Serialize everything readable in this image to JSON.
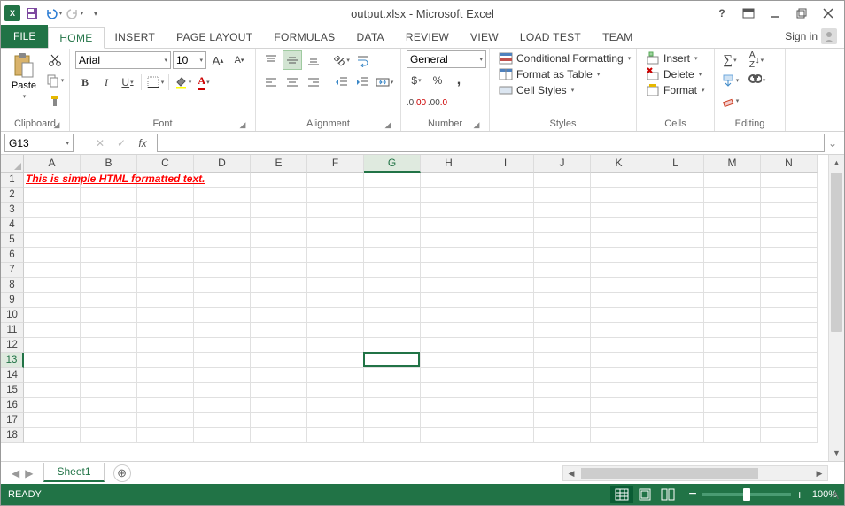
{
  "title": "output.xlsx - Microsoft Excel",
  "qat": {
    "save": "💾"
  },
  "signin_label": "Sign in",
  "tabs": {
    "file": "FILE",
    "home": "HOME",
    "insert": "INSERT",
    "page_layout": "PAGE LAYOUT",
    "formulas": "FORMULAS",
    "data": "DATA",
    "review": "REVIEW",
    "view": "VIEW",
    "load_test": "LOAD TEST",
    "team": "TEAM"
  },
  "ribbon": {
    "clipboard": {
      "label": "Clipboard",
      "paste": "Paste"
    },
    "font": {
      "label": "Font",
      "name": "Arial",
      "size": "10",
      "B": "B",
      "I": "I",
      "U": "U"
    },
    "alignment": {
      "label": "Alignment"
    },
    "number": {
      "label": "Number",
      "format": "General",
      "currency": "$",
      "percent": "%",
      "comma": ","
    },
    "styles": {
      "label": "Styles",
      "cond_fmt": "Conditional Formatting",
      "table": "Format as Table",
      "cell": "Cell Styles"
    },
    "cells": {
      "label": "Cells",
      "insert": "Insert",
      "delete": "Delete",
      "format": "Format"
    },
    "editing": {
      "label": "Editing"
    }
  },
  "namebox": "G13",
  "formula": "",
  "columns": [
    "A",
    "B",
    "C",
    "D",
    "E",
    "F",
    "G",
    "H",
    "I",
    "J",
    "K",
    "L",
    "M",
    "N"
  ],
  "rows": [
    1,
    2,
    3,
    4,
    5,
    6,
    7,
    8,
    9,
    10,
    11,
    12,
    13,
    14,
    15,
    16,
    17,
    18
  ],
  "cell_A1": "This is simple HTML formatted text.",
  "active_col": "G",
  "active_row": 13,
  "sheet": {
    "name": "Sheet1"
  },
  "status": {
    "ready": "READY",
    "zoom": "100%"
  }
}
